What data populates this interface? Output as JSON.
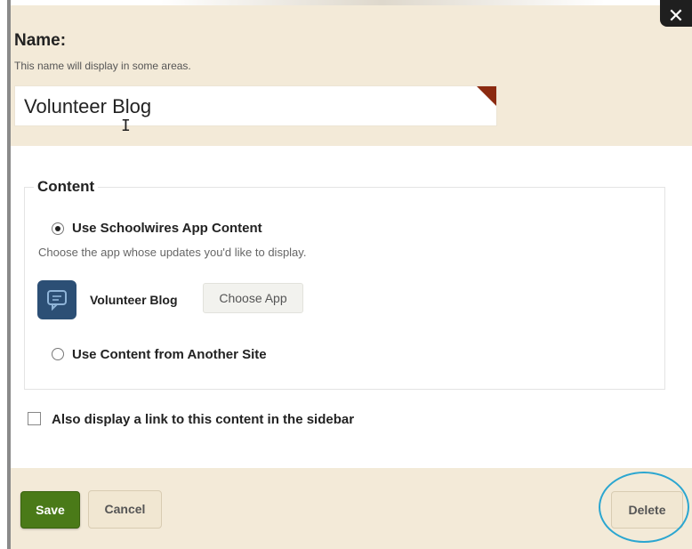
{
  "name_section": {
    "title": "Name:",
    "help": "This name will display in some areas.",
    "value": "Volunteer Blog"
  },
  "close_label": "✕",
  "content": {
    "legend": "Content",
    "option_app_label": "Use Schoolwires App Content",
    "option_app_selected": true,
    "option_app_help": "Choose the app whose updates you'd like to display.",
    "app_name": "Volunteer Blog",
    "app_icon": "chat-bubble-icon",
    "choose_app_label": "Choose App",
    "option_other_label": "Use Content from Another Site"
  },
  "sidebar_link": {
    "label": "Also display a link to this content in the sidebar",
    "checked": false
  },
  "footer": {
    "save_label": "Save",
    "cancel_label": "Cancel",
    "delete_label": "Delete"
  },
  "colors": {
    "panel_bg": "#f3ead8",
    "save_green": "#4a7a18",
    "app_icon_blue": "#2c4f75",
    "highlight": "#2ba6d0",
    "required_flag": "#8b2a10"
  }
}
